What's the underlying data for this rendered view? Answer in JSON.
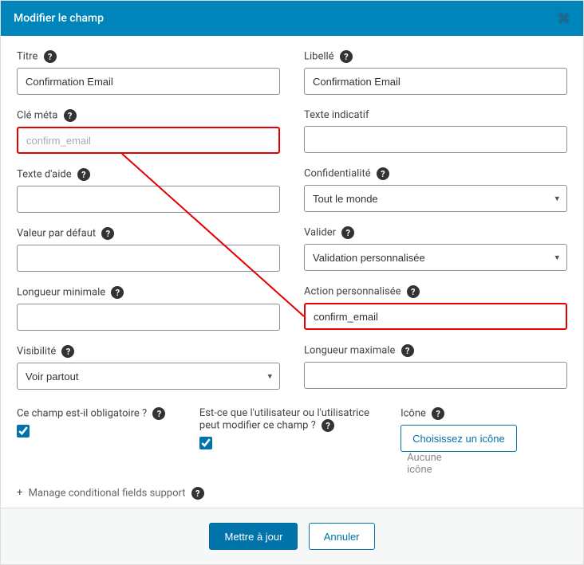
{
  "header": {
    "title": "Modifier le champ"
  },
  "left": {
    "titre_label": "Titre",
    "titre_value": "Confirmation Email",
    "cle_meta_label": "Clé méta",
    "cle_meta_value": "confirm_email",
    "texte_aide_label": "Texte d'aide",
    "texte_aide_value": "",
    "valeur_defaut_label": "Valeur par défaut",
    "valeur_defaut_value": "",
    "longueur_min_label": "Longueur minimale",
    "longueur_min_value": "",
    "visibilite_label": "Visibilité",
    "visibilite_value": "Voir partout"
  },
  "right": {
    "libelle_label": "Libellé",
    "libelle_value": "Confirmation Email",
    "texte_indicatif_label": "Texte indicatif",
    "texte_indicatif_value": "",
    "confidentialite_label": "Confidentialité",
    "confidentialite_value": "Tout le monde",
    "valider_label": "Valider",
    "valider_value": "Validation personnalisée",
    "action_perso_label": "Action personnalisée",
    "action_perso_value": "confirm_email",
    "longueur_max_label": "Longueur maximale",
    "longueur_max_value": ""
  },
  "bottom": {
    "obligatoire_label": "Ce champ est-il obligatoire ?",
    "obligatoire_checked": true,
    "modifiable_label": "Est-ce que l'utilisateur ou l'utilisatrice peut modifier ce champ ?",
    "modifiable_checked": true,
    "icone_label": "Icône",
    "icone_button": "Choisissez un icône",
    "icone_text": "Aucune icône",
    "conditional_label": "Manage conditional fields support"
  },
  "footer": {
    "save": "Mettre à jour",
    "cancel": "Annuler"
  }
}
